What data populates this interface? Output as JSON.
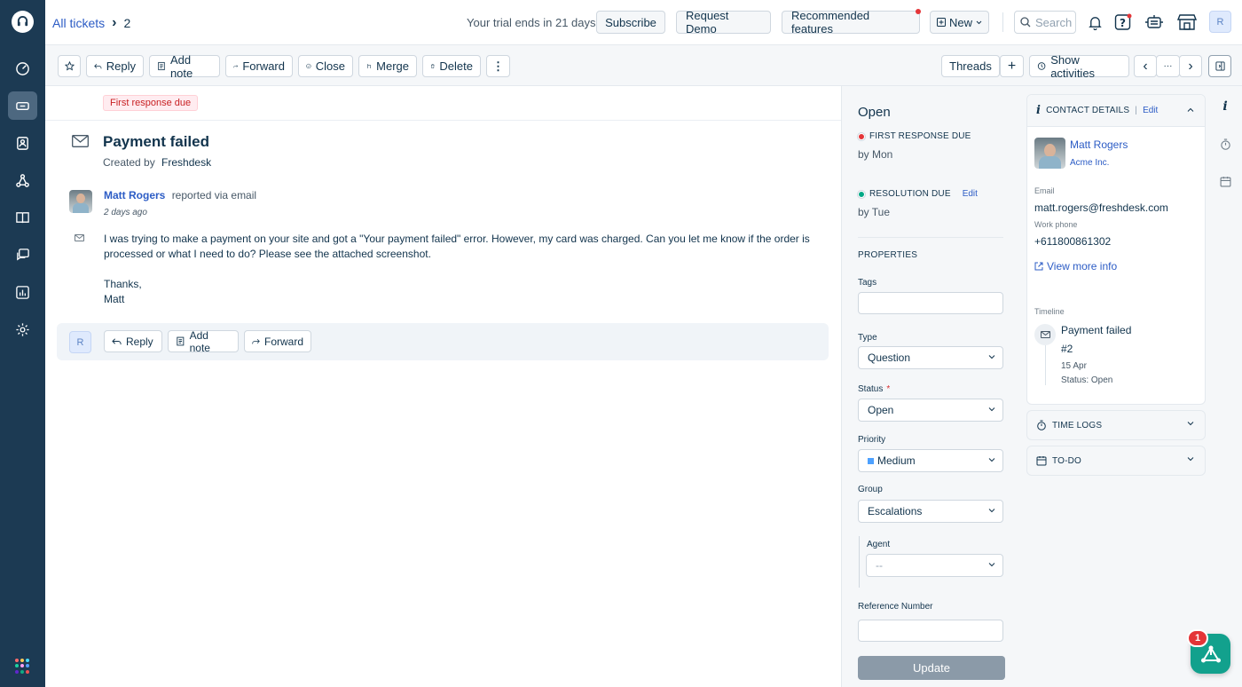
{
  "header": {
    "breadcrumb_root": "All tickets",
    "breadcrumb_sep": ">",
    "ticket_number": "2",
    "trial_text": "Your trial ends in 21 days",
    "subscribe_label": "Subscribe",
    "demo_label": "Request Demo",
    "recommended_label": "Recommended features",
    "new_label": "New",
    "search_placeholder": "Search",
    "user_initial": "R"
  },
  "toolbar": {
    "reply": "Reply",
    "add_note": "Add note",
    "forward": "Forward",
    "close": "Close",
    "merge": "Merge",
    "delete": "Delete",
    "more": "⋮",
    "threads": "Threads",
    "add": "+",
    "show_activities": "Show activities",
    "prev": "‹",
    "ellipsis": "···",
    "next": "›"
  },
  "ticket": {
    "sla_badge": "First response due",
    "subject": "Payment failed",
    "created_by_label": "Created by",
    "created_by": "Freshdesk",
    "sender_name": "Matt Rogers",
    "sender_via": "reported via email",
    "time_ago": "2 days ago",
    "body_para1": "I was trying to make a payment on your site and got a \"Your payment failed\" error. However, my card was charged. Can you let me know if the order is processed or what I need to do? Please see the attached screenshot.",
    "body_thanks": "Thanks,",
    "body_sign": "Matt",
    "reply_avatar": "R",
    "reply_button": "Reply",
    "note_button": "Add note",
    "forward_button": "Forward"
  },
  "properties": {
    "status_title": "Open",
    "first_response_label": "FIRST RESPONSE DUE",
    "first_response_by": "by Mon",
    "first_response_color": "#e43538",
    "resolution_label": "RESOLUTION DUE",
    "resolution_edit": "Edit",
    "resolution_by": "by Tue",
    "resolution_color": "#00a886",
    "section_title": "PROPERTIES",
    "tags_label": "Tags",
    "type_label": "Type",
    "type_value": "Question",
    "status_label": "Status",
    "status_required": "*",
    "status_value": "Open",
    "priority_label": "Priority",
    "priority_value": "Medium",
    "priority_color": "#4da1ff",
    "group_label": "Group",
    "group_value": "Escalations",
    "agent_label": "Agent",
    "agent_value": "--",
    "reference_label": "Reference Number",
    "update_button": "Update"
  },
  "contact": {
    "header": "CONTACT DETAILS",
    "sep": "|",
    "edit": "Edit",
    "name": "Matt Rogers",
    "company": "Acme Inc.",
    "email_label": "Email",
    "email": "matt.rogers@freshdesk.com",
    "phone_label": "Work phone",
    "phone": "+611800861302",
    "view_more": "View more info",
    "timeline_label": "Timeline",
    "timeline_title": "Payment failed",
    "timeline_number": "#2",
    "timeline_date": "15 Apr",
    "timeline_status": "Status: Open"
  },
  "accordions": {
    "time_logs": "TIME LOGS",
    "todo": "TO-DO"
  },
  "widget": {
    "badge_count": "1"
  },
  "colors": {
    "sidebar_bg": "#1c3a53",
    "link_blue": "#2c5cc5",
    "widget_green": "#12a18d"
  }
}
